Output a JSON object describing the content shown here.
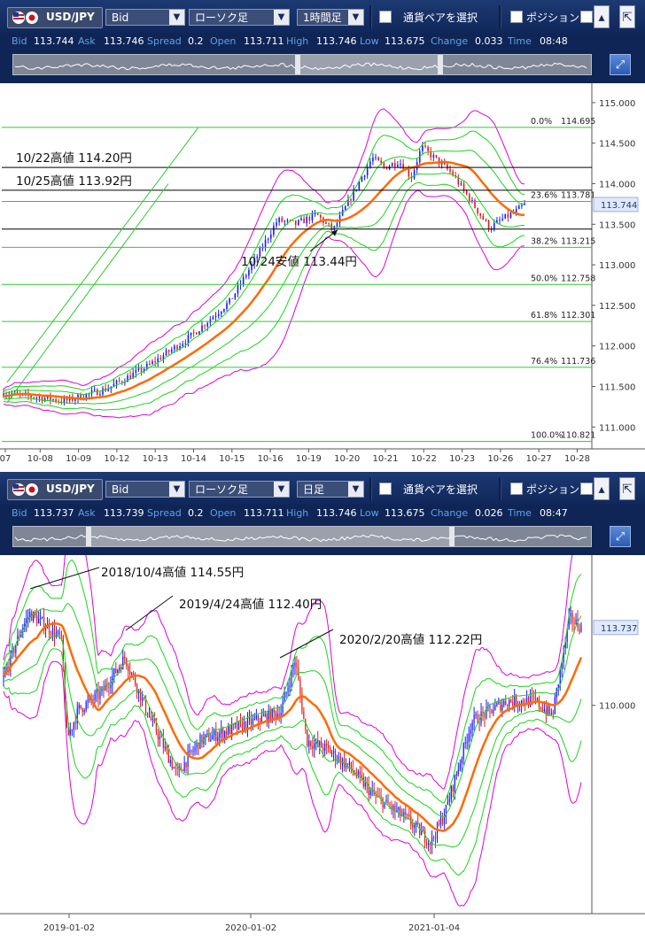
{
  "toolbar_top": {
    "pair": "USD/JPY",
    "price_type": "Bid",
    "chart_type": "ローソク足",
    "timeframe": "1時間足",
    "pair_select": "通貨ペアを選択",
    "position": "ポジション"
  },
  "quotes_top": {
    "bid_label": "Bid",
    "bid": "113.744",
    "ask_label": "Ask",
    "ask": "113.746",
    "spread_label": "Spread",
    "spread": "0.2",
    "open_label": "Open",
    "open": "113.711",
    "high_label": "High",
    "high": "113.746",
    "low_label": "Low",
    "low": "113.675",
    "change_label": "Change",
    "change": "0.033",
    "time_label": "Time",
    "time": "08:48"
  },
  "toolbar_bottom": {
    "pair": "USD/JPY",
    "price_type": "Bid",
    "chart_type": "ローソク足",
    "timeframe": "日足",
    "pair_select": "通貨ペアを選択",
    "position": "ポジション"
  },
  "quotes_bottom": {
    "bid_label": "Bid",
    "bid": "113.737",
    "ask_label": "Ask",
    "ask": "113.739",
    "spread_label": "Spread",
    "spread": "0.2",
    "open_label": "Open",
    "open": "113.711",
    "high_label": "High",
    "high": "113.746",
    "low_label": "Low",
    "low": "113.675",
    "change_label": "Change",
    "change": "0.026",
    "time_label": "Time",
    "time": "08:47"
  },
  "colors": {
    "bull": "#1a1aff",
    "bear": "#e01a1a",
    "ma": "#ff6a00",
    "band_inner": "#19d619",
    "band_outer": "#e000e0",
    "fib": "#2ecc2e",
    "hline": "#000000",
    "price_box": "#dfe9fb"
  },
  "chart_data": [
    {
      "type": "candlestick",
      "timeframe": "1時間足",
      "x_tick_labels": [
        "07",
        "10-08",
        "10-09",
        "10-12",
        "10-13",
        "10-14",
        "10-15",
        "10-16",
        "10-19",
        "10-20",
        "10-21",
        "10-22",
        "10-23",
        "10-26",
        "10-27",
        "10-28"
      ],
      "y_tick_labels": [
        "115.000",
        "114.500",
        "114.000",
        "113.500",
        "113.000",
        "112.500",
        "112.000",
        "111.500",
        "111.000"
      ],
      "ylim": [
        110.73,
        115.13
      ],
      "last_price": "113.744",
      "price_path": [
        [
          0,
          111.42
        ],
        [
          3,
          111.32
        ],
        [
          5,
          111.47
        ],
        [
          7,
          111.75
        ],
        [
          9,
          112.1
        ],
        [
          11,
          112.55
        ],
        [
          12.3,
          113.1
        ],
        [
          13.3,
          113.55
        ],
        [
          14.2,
          113.5
        ],
        [
          15.2,
          113.62
        ],
        [
          16,
          113.42
        ],
        [
          16.8,
          113.8
        ],
        [
          17.4,
          114.08
        ],
        [
          17.9,
          114.32
        ],
        [
          18.5,
          114.2
        ],
        [
          19.2,
          114.28
        ],
        [
          19.8,
          114.08
        ],
        [
          20.3,
          114.45
        ],
        [
          21,
          114.3
        ],
        [
          21.8,
          114.12
        ],
        [
          22.5,
          113.86
        ],
        [
          23.2,
          113.6
        ],
        [
          23.6,
          113.45
        ],
        [
          24.2,
          113.56
        ],
        [
          24.8,
          113.64
        ],
        [
          25.3,
          113.74
        ]
      ],
      "fib_levels": [
        {
          "label": "0.0%",
          "value": "114.695"
        },
        {
          "label": "23.6%",
          "value": "113.781"
        },
        {
          "label": "38.2%",
          "value": "113.215"
        },
        {
          "label": "50.0%",
          "value": "112.758"
        },
        {
          "label": "61.8%",
          "value": "112.301"
        },
        {
          "label": "76.4%",
          "value": "111.736"
        },
        {
          "label": "100.0%",
          "value": "110.821"
        }
      ],
      "horizontal_lines": [
        114.2,
        113.92,
        113.44
      ],
      "annotations": [
        "10/22高値 114.20円",
        "10/25高値 113.92円",
        "10/24安値 113.44円"
      ],
      "series": [
        "移動平均",
        "ボリンジャーバンド ±2σ",
        "ボリンジャーバンド ±3σ"
      ]
    },
    {
      "type": "candlestick",
      "timeframe": "日足",
      "x_tick_labels": [
        "2019-01-02",
        "2020-01-02",
        "2021-01-04"
      ],
      "y_tick_labels": [
        "110.000"
      ],
      "ylim": [
        100.0,
        117.0
      ],
      "last_price": "113.737",
      "price_path": [
        [
          0,
          111.3
        ],
        [
          0.03,
          113.6
        ],
        [
          0.045,
          114.4
        ],
        [
          0.07,
          113.9
        ],
        [
          0.1,
          113.2
        ],
        [
          0.11,
          108.4
        ],
        [
          0.13,
          109.8
        ],
        [
          0.17,
          110.6
        ],
        [
          0.21,
          112.3
        ],
        [
          0.25,
          109.6
        ],
        [
          0.3,
          106.7
        ],
        [
          0.34,
          108.3
        ],
        [
          0.4,
          108.9
        ],
        [
          0.45,
          109.4
        ],
        [
          0.48,
          109.7
        ],
        [
          0.505,
          112.2
        ],
        [
          0.525,
          108.3
        ],
        [
          0.56,
          107.9
        ],
        [
          0.6,
          107.0
        ],
        [
          0.64,
          105.7
        ],
        [
          0.7,
          104.5
        ],
        [
          0.74,
          103.4
        ],
        [
          0.765,
          104.9
        ],
        [
          0.81,
          109.2
        ],
        [
          0.87,
          110.2
        ],
        [
          0.92,
          110.2
        ],
        [
          0.95,
          109.5
        ],
        [
          0.98,
          114.2
        ],
        [
          1.0,
          113.74
        ]
      ],
      "annotations": [
        "2018/10/4高値 114.55円",
        "2019/4/24高値 112.40円",
        "2020/2/20高値 112.22円"
      ],
      "series": [
        "移動平均",
        "ボリンジャーバンド ±2σ",
        "ボリンジャーバンド ±3σ"
      ]
    }
  ]
}
